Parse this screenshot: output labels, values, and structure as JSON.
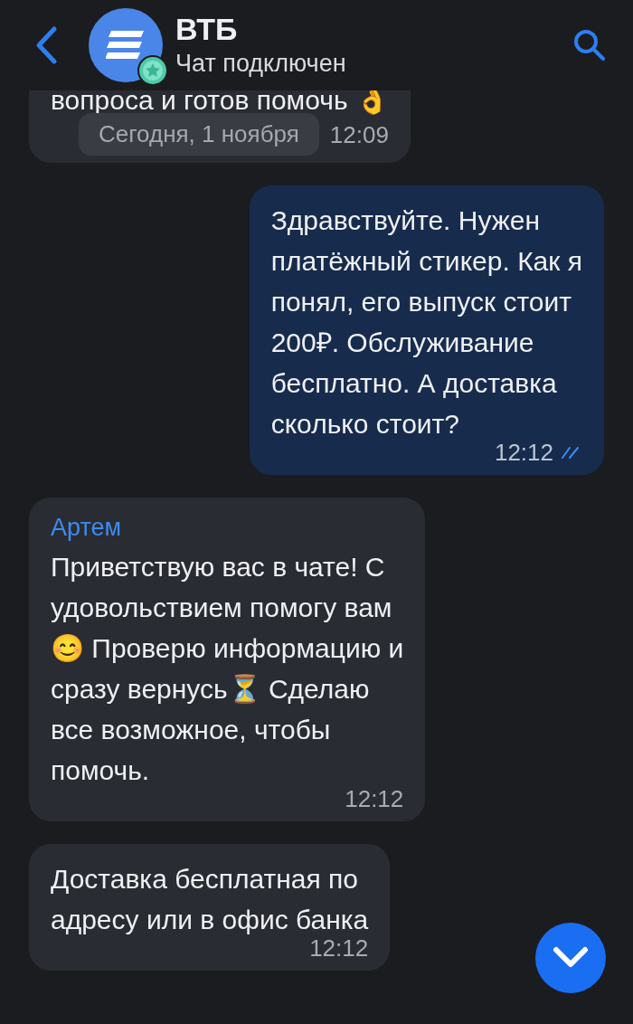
{
  "header": {
    "title": "ВТБ",
    "status": "Чат подключен",
    "verified": true
  },
  "messages": [
    {
      "kind": "in",
      "text": "вопроса и готов помочь 👌",
      "date_pill": "Сегодня, 1 ноября",
      "time": "12:09"
    },
    {
      "kind": "out",
      "text": "Здравствуйте. Нужен\nплатёжный стикер. Как я\nпонял, его выпуск стоит\n200₽. Обслуживание\nбесплатно. А доставка\nсколько стоит?",
      "time": "12:12",
      "read": true
    },
    {
      "kind": "in",
      "sender": "Артем",
      "text": "Приветствую вас в чате! С\nудовольствием помогу вам\n😊 Проверю информацию и\nсразу вернусь⏳ Сделаю\nвсе возможное, чтобы\nпомочь.",
      "time": "12:12"
    },
    {
      "kind": "in",
      "text": "Доставка бесплатная по\nадресу или в офис банка",
      "time": "12:12"
    }
  ]
}
